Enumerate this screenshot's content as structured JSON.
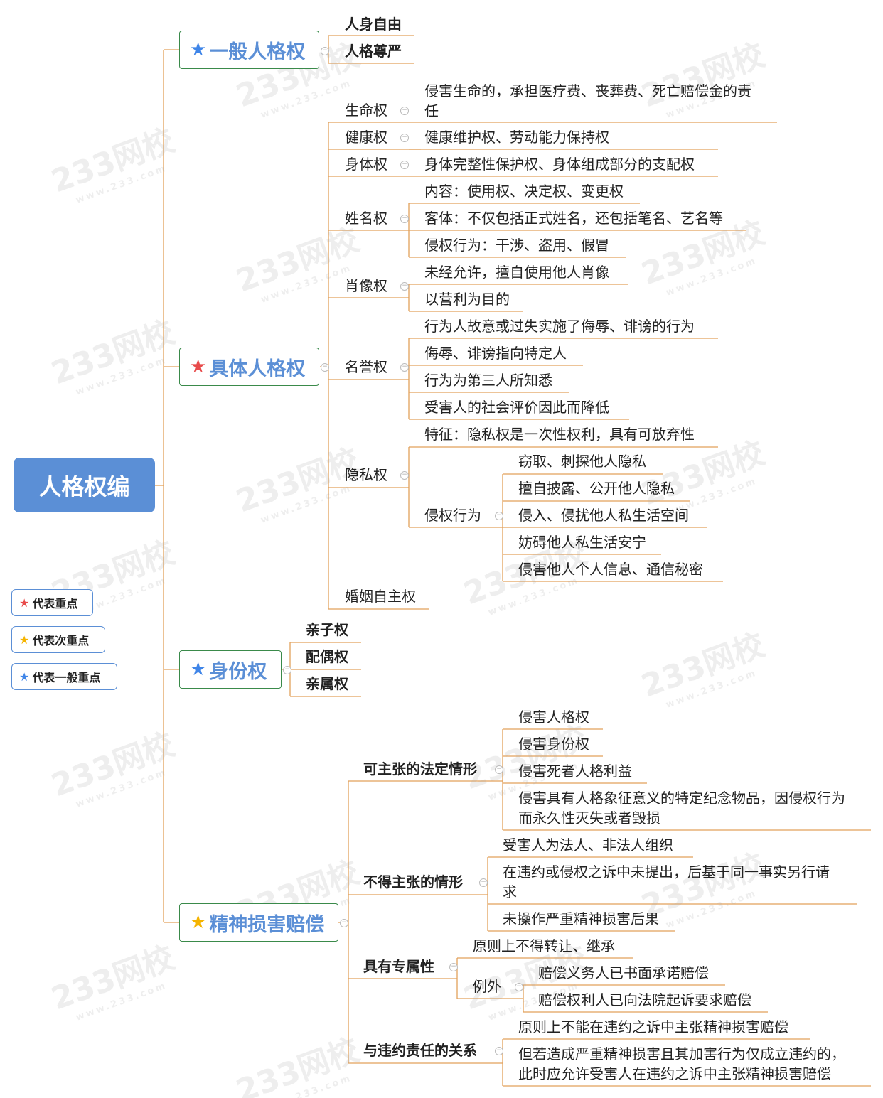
{
  "root": "人格权编",
  "colors": {
    "line": "#e2a15b",
    "box_border": "#3a8a4a",
    "root_bg": "#5b8fd6",
    "star_red": "#e84b4b",
    "star_yellow": "#f5b400",
    "star_blue": "#3f85e8",
    "text_blue": "#5b8fd6"
  },
  "legend": [
    {
      "star": "red",
      "label": "代表重点"
    },
    {
      "star": "yellow",
      "label": "代表次重点"
    },
    {
      "star": "blue",
      "label": "代表一般重点"
    }
  ],
  "watermark": {
    "main": "233网校",
    "sub": "www.233.com"
  },
  "branches": {
    "general": {
      "label": "一般人格权",
      "star": "blue",
      "children": [
        "人身自由",
        "人格尊严"
      ]
    },
    "specific": {
      "label": "具体人格权",
      "star": "red",
      "life": {
        "label": "生命权",
        "text": "侵害生命的，承担医疗费、丧葬费、死亡赔偿金的责任"
      },
      "health": {
        "label": "健康权",
        "text": "健康维护权、劳动能力保持权"
      },
      "body": {
        "label": "身体权",
        "text": "身体完整性保护权、身体组成部分的支配权"
      },
      "name": {
        "label": "姓名权",
        "items": [
          "内容：使用权、决定权、变更权",
          "客体：不仅包括正式姓名，还包括笔名、艺名等",
          "侵权行为：干涉、盗用、假冒"
        ]
      },
      "portrait": {
        "label": "肖像权",
        "items": [
          "未经允许，擅自使用他人肖像",
          "以营利为目的"
        ]
      },
      "reputation": {
        "label": "名誉权",
        "items": [
          "行为人故意或过失实施了侮辱、诽谤的行为",
          "侮辱、诽谤指向特定人",
          "行为为第三人所知悉",
          "受害人的社会评价因此而降低"
        ]
      },
      "privacy": {
        "label": "隐私权",
        "feature": "特征：隐私权是一次性权利，具有可放弃性",
        "infringe_label": "侵权行为",
        "infringe": [
          "窃取、刺探他人隐私",
          "擅自披露、公开他人隐私",
          "侵入、侵扰他人私生活空间",
          "妨碍他人私生活安宁",
          "侵害他人个人信息、通信秘密"
        ]
      },
      "marriage": {
        "label": "婚姻自主权"
      }
    },
    "identity": {
      "label": "身份权",
      "star": "blue",
      "children": [
        "亲子权",
        "配偶权",
        "亲属权"
      ]
    },
    "damage": {
      "label": "精神损害赔偿",
      "star": "yellow",
      "legal": {
        "label": "可主张的法定情形",
        "items": [
          "侵害人格权",
          "侵害身份权",
          "侵害死者人格利益",
          "侵害具有人格象征意义的特定纪念物品，因侵权行为",
          "而永久性灭失或者毁损"
        ]
      },
      "cannot": {
        "label": "不得主张的情形",
        "items": [
          "受害人为法人、非法人组织",
          "在违约或侵权之诉中未提出，后基于同一事实另行请",
          "求",
          "未操作严重精神损害后果"
        ]
      },
      "exclusive": {
        "label": "具有专属性",
        "principle": "原则上不得转让、继承",
        "exception_label": "例外",
        "exceptions": [
          "赔偿义务人已书面承诺赔偿",
          "赔偿权利人已向法院起诉要求赔偿"
        ]
      },
      "contract": {
        "label": "与违约责任的关系",
        "items": [
          "原则上不能在违约之诉中主张精神损害赔偿",
          "但若造成严重精神损害且其加害行为仅成立违约的，",
          "此时应允许受害人在违约之诉中主张精神损害赔偿"
        ]
      }
    }
  }
}
